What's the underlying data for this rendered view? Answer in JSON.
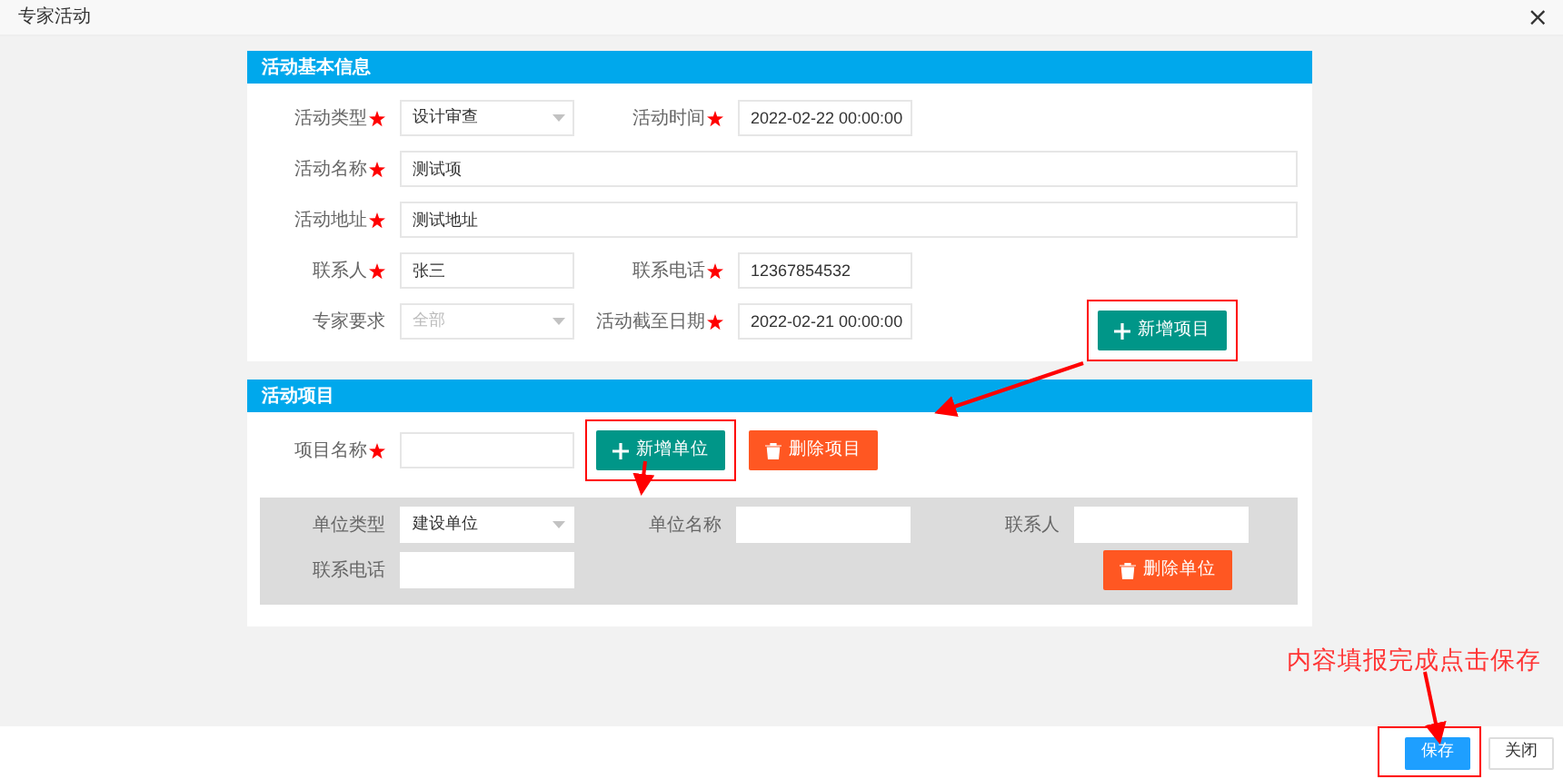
{
  "window": {
    "title": "专家活动",
    "close": "×"
  },
  "basic_info": {
    "title": "活动基本信息",
    "rows": [
      {
        "fields": [
          {
            "label": "活动类型",
            "required": true,
            "kind": "select",
            "value": "设计审查"
          },
          {
            "label": "活动时间",
            "required": true,
            "kind": "input",
            "value": "2022-02-22 00:00:00"
          }
        ]
      },
      {
        "fields": [
          {
            "label": "活动名称",
            "required": true,
            "kind": "wide",
            "value": "测试项"
          }
        ]
      },
      {
        "fields": [
          {
            "label": "活动地址",
            "required": true,
            "kind": "wide",
            "value": "测试地址"
          }
        ]
      },
      {
        "fields": [
          {
            "label": "联系人",
            "required": true,
            "kind": "input",
            "value": "张三"
          },
          {
            "label": "联系电话",
            "required": true,
            "kind": "input",
            "value": "12367854532"
          }
        ]
      },
      {
        "fields": [
          {
            "label": "专家要求",
            "required": false,
            "kind": "select",
            "placeholder": "全部"
          },
          {
            "label": "活动截至日期",
            "required": true,
            "kind": "input",
            "value": "2022-02-21 00:00:00"
          }
        ],
        "button": {
          "label": "新增项目",
          "highlighted": true
        }
      }
    ]
  },
  "project": {
    "title": "活动项目",
    "name_field": {
      "label": "项目名称",
      "required": true
    },
    "buttons": [
      {
        "label": "新增单位",
        "kind": "add",
        "highlighted": true
      },
      {
        "label": "删除项目",
        "kind": "delete",
        "highlighted": false
      }
    ],
    "unit": {
      "fields": [
        {
          "label": "单位类型",
          "kind": "select",
          "value": "建设单位"
        },
        {
          "label": "单位名称",
          "kind": "input"
        },
        {
          "label": "联系人",
          "kind": "input"
        },
        {
          "label": "联系电话",
          "kind": "input"
        }
      ],
      "delete_button": "删除单位"
    }
  },
  "annotation": "内容填报完成点击保存",
  "footer": {
    "buttons": [
      {
        "label": "保存",
        "primary": true,
        "highlighted": true
      },
      {
        "label": "关闭",
        "primary": false,
        "highlighted": false
      }
    ]
  }
}
